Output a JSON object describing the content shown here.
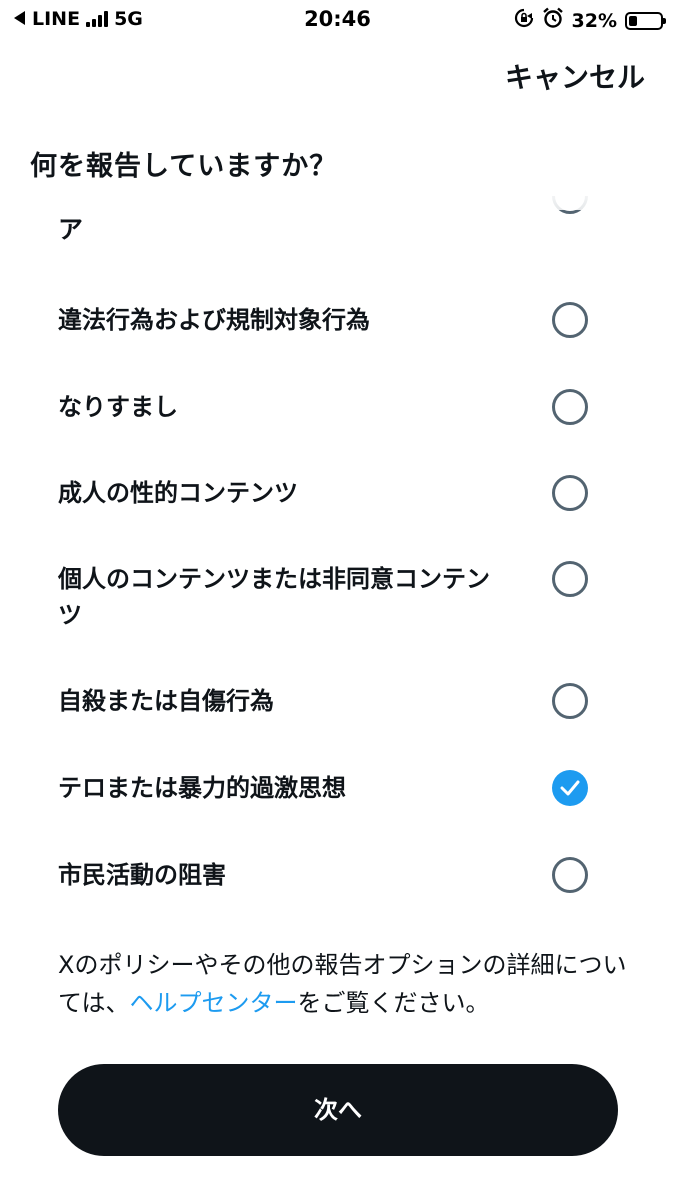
{
  "status_bar": {
    "back_app": "LINE",
    "network": "5G",
    "time": "20:46",
    "battery_percent": "32%",
    "battery_level": 0.32,
    "icons": [
      "back-triangle-icon",
      "signal-bars-icon",
      "rotation-lock-icon",
      "alarm-icon",
      "battery-icon"
    ]
  },
  "header": {
    "cancel_label": "キャンセル",
    "title": "何を報告していますか？"
  },
  "cut_off_item": {
    "label_fragment": "ア"
  },
  "options": [
    {
      "label": "違法行為および規制対象行為",
      "selected": false
    },
    {
      "label": "なりすまし",
      "selected": false
    },
    {
      "label": "成人の性的コンテンツ",
      "selected": false
    },
    {
      "label": "個人のコンテンツまたは非同意コンテンツ",
      "selected": false
    },
    {
      "label": "自殺または自傷行為",
      "selected": false
    },
    {
      "label": "テロまたは暴力的過激思想",
      "selected": true
    },
    {
      "label": "市民活動の阻害",
      "selected": false
    }
  ],
  "footer": {
    "text_before": "Xのポリシーやその他の報告オプションの詳細については、",
    "link": "ヘルプセンター",
    "text_after": "をご覧ください。"
  },
  "next_button_label": "次へ",
  "colors": {
    "accent": "#1d9bf0",
    "text": "#0f1419",
    "radio_border": "#536471",
    "button_bg": "#0f1419"
  }
}
